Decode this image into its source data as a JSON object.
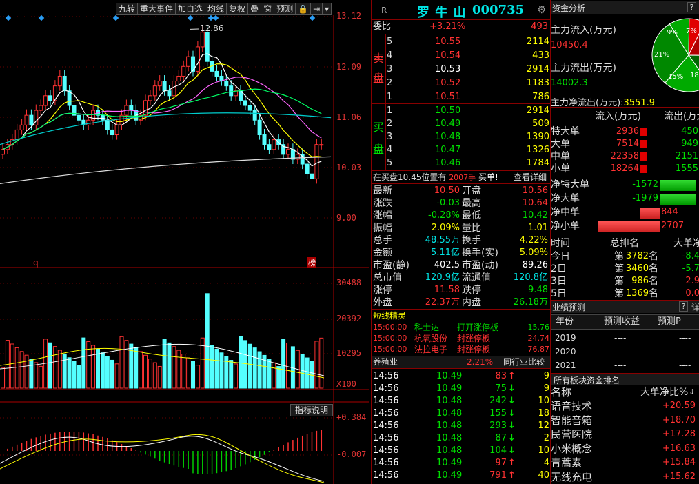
{
  "toolbar": [
    "九转",
    "重大事件",
    "加自选",
    "均线",
    "复权",
    "叠",
    "窗",
    "预测",
    "🔒",
    "⇥",
    "▾"
  ],
  "price_axis": [
    "13.12",
    "12.09",
    "11.06",
    "10.03",
    "9.00"
  ],
  "high_label": "12.86",
  "kline_marks": {
    "q": "q",
    "bang": "榜"
  },
  "vol_axis": [
    "30488",
    "20392",
    "10295",
    "X100"
  ],
  "ind_axis": [
    "+0.384",
    "-0.007"
  ],
  "ind_btn": "指标说明",
  "stock": {
    "mark": "R",
    "name": "罗 牛 山",
    "code": "000735"
  },
  "weibi": {
    "label": "委比",
    "pct": "+3.21%",
    "val": "493"
  },
  "sell_label": "卖盘",
  "buy_label": "买盘",
  "sells": [
    {
      "n": "5",
      "p": "10.55",
      "v": "2114"
    },
    {
      "n": "4",
      "p": "10.54",
      "v": "433"
    },
    {
      "n": "3",
      "p": "10.53",
      "v": "2914"
    },
    {
      "n": "2",
      "p": "10.52",
      "v": "1183"
    },
    {
      "n": "1",
      "p": "10.51",
      "v": "786"
    }
  ],
  "buys": [
    {
      "n": "1",
      "p": "10.50",
      "v": "2914"
    },
    {
      "n": "2",
      "p": "10.49",
      "v": "509"
    },
    {
      "n": "3",
      "p": "10.48",
      "v": "1390"
    },
    {
      "n": "4",
      "p": "10.47",
      "v": "1326"
    },
    {
      "n": "5",
      "p": "10.46",
      "v": "1784"
    }
  ],
  "buy_note": {
    "text": "在买盘10.45位置有",
    "qty": "2007手",
    "act": "买单!",
    "link": "查看详细"
  },
  "quote": [
    {
      "l": "最新",
      "v": "10.50",
      "c": "red",
      "l2": "开盘",
      "v2": "10.56",
      "c2": "red"
    },
    {
      "l": "涨跌",
      "v": "-0.03",
      "c": "grn",
      "l2": "最高",
      "v2": "10.64",
      "c2": "red"
    },
    {
      "l": "涨幅",
      "v": "-0.28%",
      "c": "grn",
      "l2": "最低",
      "v2": "10.42",
      "c2": "grn"
    },
    {
      "l": "振幅",
      "v": "2.09%",
      "c": "yel",
      "l2": "量比",
      "v2": "1.01",
      "c2": "yel"
    },
    {
      "l": "总手",
      "v": "48.55万",
      "c": "cya",
      "l2": "换手",
      "v2": "4.22%",
      "c2": "yel"
    },
    {
      "l": "金额",
      "v": "5.11亿",
      "c": "cya",
      "l2": "换手(实)",
      "v2": "5.09%",
      "c2": "yel"
    },
    {
      "l": "市盈(静)",
      "v": "402.5",
      "c": "wht",
      "l2": "市盈(动)",
      "v2": "89.26",
      "c2": "wht"
    },
    {
      "l": "总市值",
      "v": "120.9亿",
      "c": "cya",
      "l2": "流通值",
      "v2": "120.8亿",
      "c2": "cya"
    },
    {
      "l": "涨停",
      "v": "11.58",
      "c": "red",
      "l2": "跌停",
      "v2": "9.48",
      "c2": "grn"
    },
    {
      "l": "外盘",
      "v": "22.37万",
      "c": "red",
      "l2": "内盘",
      "v2": "26.18万",
      "c2": "grn"
    }
  ],
  "sprite": {
    "title": "短线精灵",
    "rows": [
      {
        "t": "15:00:00",
        "n": "科士达",
        "e": "打开涨停板",
        "v": "15.76",
        "c": "grn"
      },
      {
        "t": "15:00:00",
        "n": "杭氧股份",
        "e": "封涨停板",
        "v": "24.74",
        "c": "red"
      },
      {
        "t": "15:00:00",
        "n": "法拉电子",
        "e": "封涨停板",
        "v": "76.87",
        "c": "red"
      }
    ]
  },
  "industry": {
    "name": "养殖业",
    "pct": "2.21%",
    "btn": "同行业比较"
  },
  "ticks": [
    {
      "t": "14:56",
      "p": "10.49",
      "v": "83",
      "d": "↑",
      "n": "9"
    },
    {
      "t": "14:56",
      "p": "10.49",
      "v": "75",
      "d": "↓",
      "n": "9"
    },
    {
      "t": "14:56",
      "p": "10.48",
      "v": "242",
      "d": "↓",
      "n": "10"
    },
    {
      "t": "14:56",
      "p": "10.48",
      "v": "155",
      "d": "↓",
      "n": "18"
    },
    {
      "t": "14:56",
      "p": "10.48",
      "v": "293",
      "d": "↓",
      "n": "12"
    },
    {
      "t": "14:56",
      "p": "10.48",
      "v": "87",
      "d": "↓",
      "n": "2"
    },
    {
      "t": "14:56",
      "p": "10.48",
      "v": "104",
      "d": "↓",
      "n": "10"
    },
    {
      "t": "14:56",
      "p": "10.49",
      "v": "97",
      "d": "↑",
      "n": "4"
    },
    {
      "t": "14:56",
      "p": "10.49",
      "v": "791",
      "d": "↑",
      "n": "40"
    }
  ],
  "fund": {
    "title": "资金分析",
    "help": "?",
    "in_label": "主力流入(万元)",
    "in_val": "10450.4",
    "out_label": "主力流出(万元)",
    "out_val": "14002.3",
    "net_label": "主力净流出(万元):",
    "net_val": "3551.9"
  },
  "pie": {
    "labels": [
      "9%",
      "7%",
      "21%",
      "15%",
      "18"
    ],
    "colors": [
      "#00aa00",
      "#e00000",
      "#00aa00",
      "#00aa00",
      "#e00000"
    ]
  },
  "flow": {
    "headers": [
      "流入(万元)",
      "流出(万元)"
    ],
    "rows": [
      {
        "l": "特大单",
        "in": "2936",
        "out": "450"
      },
      {
        "l": "大单",
        "in": "7514",
        "out": "949"
      },
      {
        "l": "中单",
        "in": "22358",
        "out": "2151"
      },
      {
        "l": "小单",
        "in": "18264",
        "out": "1555"
      }
    ]
  },
  "net": [
    {
      "l": "净特大单",
      "v": "-1572",
      "c": "grn",
      "w": 0.96
    },
    {
      "l": "净大单",
      "v": "-1979",
      "c": "grn",
      "w": 0.96
    },
    {
      "l": "净中单",
      "v": "844",
      "c": "red",
      "w": 0.32
    },
    {
      "l": "净小单",
      "v": "2707",
      "c": "red",
      "w": 1.0
    }
  ],
  "rank": {
    "headers": [
      "时间",
      "总排名",
      "大单净"
    ],
    "rows": [
      {
        "l": "今日",
        "r": "3782",
        "v": "-8.4",
        "c": "grn"
      },
      {
        "l": "2日",
        "r": "3460",
        "v": "-5.7",
        "c": "grn"
      },
      {
        "l": "3日",
        "r": "986",
        "v": "2.9",
        "c": "red"
      },
      {
        "l": "5日",
        "r": "1369",
        "v": "0.0",
        "c": "red"
      }
    ],
    "pre": "第",
    "suf": "名"
  },
  "forecast": {
    "title": "业绩预测",
    "help": "?",
    "detail": "详",
    "headers": [
      "年份",
      "预测收益",
      "预测P"
    ],
    "rows": [
      {
        "y": "2019",
        "a": "----",
        "b": "----"
      },
      {
        "y": "2020",
        "a": "----",
        "b": "----"
      },
      {
        "y": "2021",
        "a": "----",
        "b": "----"
      }
    ]
  },
  "sector": {
    "title": "所有板块资金排名",
    "headers": [
      "名称",
      "大单净比%"
    ],
    "rows": [
      {
        "n": "语音技术",
        "v": "+20.59"
      },
      {
        "n": "智能音箱",
        "v": "+18.70"
      },
      {
        "n": "民营医院",
        "v": "+17.28"
      },
      {
        "n": "小米概念",
        "v": "+16.63"
      },
      {
        "n": "青蒿素",
        "v": "+15.84"
      },
      {
        "n": "无线充电",
        "v": "+15.62"
      }
    ]
  }
}
